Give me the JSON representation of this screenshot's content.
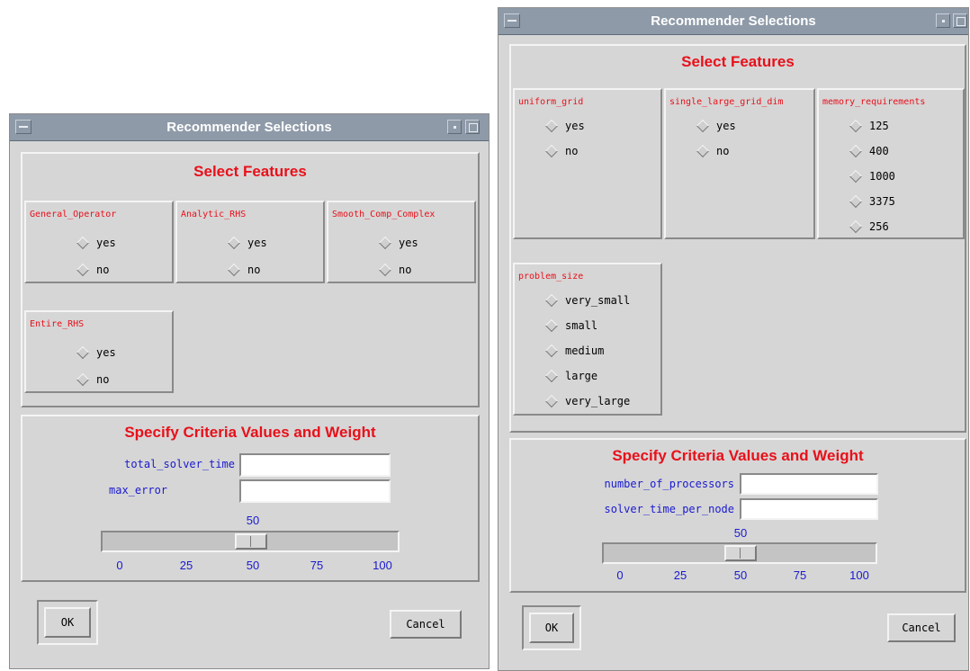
{
  "left_window": {
    "title": "Recommender Selections",
    "features_heading": "Select Features",
    "features": [
      {
        "label": "General_Operator",
        "options": [
          "yes",
          "no"
        ]
      },
      {
        "label": "Analytic_RHS",
        "options": [
          "yes",
          "no"
        ]
      },
      {
        "label": "Smooth_Comp_Complex",
        "options": [
          "yes",
          "no"
        ]
      },
      {
        "label": "Entire_RHS",
        "options": [
          "yes",
          "no"
        ]
      }
    ],
    "criteria_heading": "Specify Criteria Values and Weight",
    "criteria": [
      {
        "label": "total_solver_time",
        "value": ""
      },
      {
        "label": "max_error",
        "value": ""
      }
    ],
    "slider": {
      "value": "50",
      "ticks": [
        "0",
        "25",
        "50",
        "75",
        "100"
      ]
    },
    "ok_label": "OK",
    "cancel_label": "Cancel"
  },
  "right_window": {
    "title": "Recommender Selections",
    "features_heading": "Select Features",
    "features": [
      {
        "label": "uniform_grid",
        "options": [
          "yes",
          "no"
        ]
      },
      {
        "label": "single_large_grid_dim",
        "options": [
          "yes",
          "no"
        ]
      },
      {
        "label": "memory_requirements",
        "options": [
          "125",
          "400",
          "1000",
          "3375",
          "256"
        ]
      },
      {
        "label": "problem_size",
        "options": [
          "very_small",
          "small",
          "medium",
          "large",
          "very_large"
        ]
      }
    ],
    "criteria_heading": "Specify Criteria Values and Weight",
    "criteria": [
      {
        "label": "number_of_processors",
        "value": ""
      },
      {
        "label": "solver_time_per_node",
        "value": ""
      }
    ],
    "slider": {
      "value": "50",
      "ticks": [
        "0",
        "25",
        "50",
        "75",
        "100"
      ]
    },
    "ok_label": "OK",
    "cancel_label": "Cancel"
  },
  "colors": {
    "title_bar": "#8e9aa8",
    "heading_red": "#e8101a",
    "criteria_blue": "#1a1ad0",
    "panel_gray": "#d6d6d6"
  }
}
